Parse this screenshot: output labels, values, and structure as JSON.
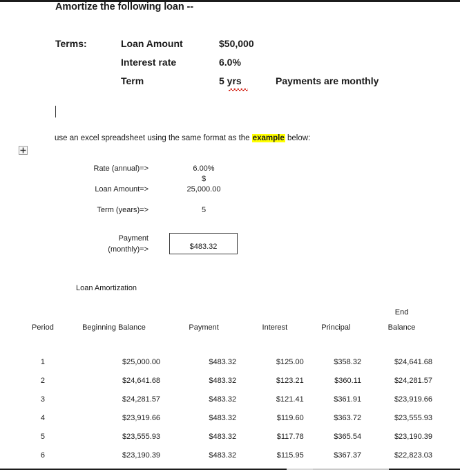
{
  "document": {
    "title": "Amortize the following loan --",
    "instruction_prefix": "use an excel spreadsheet using the same format as the ",
    "instruction_highlight": "example",
    "instruction_suffix": " below:",
    "margin_handle_icon": "expand-plus-icon",
    "caret": "text-cursor"
  },
  "terms": {
    "label": "Terms:",
    "rows": [
      {
        "name": "Loan Amount",
        "value": "$50,000"
      },
      {
        "name": "Interest rate",
        "value": "6.0%"
      },
      {
        "name": "Term",
        "value": "5 yrs"
      }
    ],
    "note": "Payments are monthly"
  },
  "inputs": {
    "rate_label": "Rate (annual)=>",
    "rate_value": "6.00%",
    "currency_symbol": "$",
    "loan_label": "Loan Amount=>",
    "loan_value": "25,000.00",
    "term_label": "Term (years)=>",
    "term_value": "5",
    "payment_label_line1": "Payment",
    "payment_label_line2": "(monthly)=>",
    "payment_value": "$483.32"
  },
  "amortization": {
    "caption": "Loan Amortization",
    "header_top": {
      "end_balance": "End"
    },
    "headers": [
      "Period",
      "Beginning Balance",
      "Payment",
      "Interest",
      "Principal",
      "Balance"
    ],
    "rows": [
      {
        "period": "1",
        "beginning": "$25,000.00",
        "payment": "$483.32",
        "interest": "$125.00",
        "principal": "$358.32",
        "ending": "$24,641.68"
      },
      {
        "period": "2",
        "beginning": "$24,641.68",
        "payment": "$483.32",
        "interest": "$123.21",
        "principal": "$360.11",
        "ending": "$24,281.57"
      },
      {
        "period": "3",
        "beginning": "$24,281.57",
        "payment": "$483.32",
        "interest": "$121.41",
        "principal": "$361.91",
        "ending": "$23,919.66"
      },
      {
        "period": "4",
        "beginning": "$23,919.66",
        "payment": "$483.32",
        "interest": "$119.60",
        "principal": "$363.72",
        "ending": "$23,555.93"
      },
      {
        "period": "5",
        "beginning": "$23,555.93",
        "payment": "$483.32",
        "interest": "$117.78",
        "principal": "$365.54",
        "ending": "$23,190.39"
      },
      {
        "period": "6",
        "beginning": "$23,190.39",
        "payment": "$483.32",
        "interest": "$115.95",
        "principal": "$367.37",
        "ending": "$22,823.03"
      }
    ]
  },
  "colors": {
    "highlight": "#ffff00",
    "rule": "#1c1c1c",
    "spellcheck_underline": "#d42a1e",
    "text": "#1a1a1a"
  }
}
